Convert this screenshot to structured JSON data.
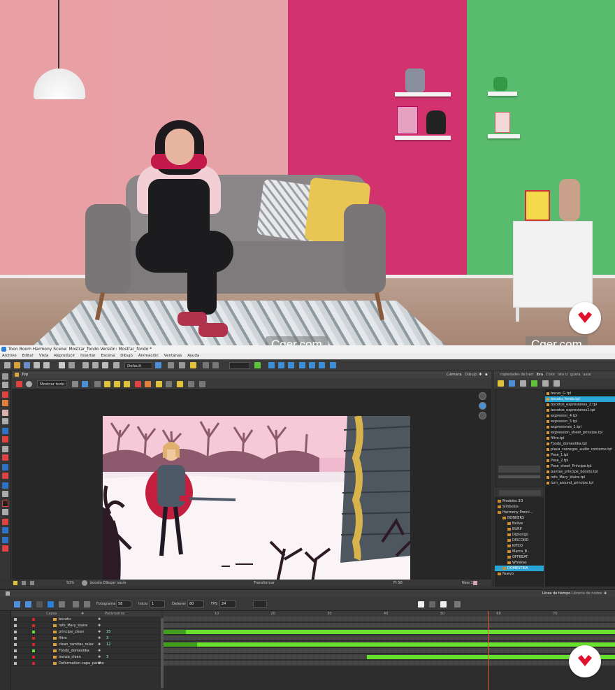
{
  "watermarks": [
    "Cger.com",
    "Cger.com"
  ],
  "app": {
    "title": "Toon Boom Harmony Scene: Mostrar_fondo Versión: Mostrar_fondo *",
    "menu": [
      "Archivo",
      "Editar",
      "Vista",
      "Reproducir",
      "Insertar",
      "Escena",
      "Dibujo",
      "Animación",
      "Ventanas",
      "Ayuda"
    ],
    "toolbar": {
      "workspace_select": "Default",
      "colors": {
        "accent": "#2aa6d6",
        "exposure": "#67e12d"
      }
    },
    "viewport": {
      "tab": "Top",
      "right_tabs": [
        "Cámara",
        "Dibujo"
      ],
      "show_select": "Mostrar todo",
      "status": {
        "zoom": "50%",
        "drawing": "boceto Dibujar vacío",
        "tool": "Transformar",
        "frame": "Ft 58",
        "view": "New 1"
      }
    },
    "library_panel": {
      "tabs": [
        "ropiedades de herr",
        "ibra",
        "Color",
        "ista d",
        "guera",
        "asso"
      ],
      "files": [
        "bocas_G.tpl",
        "boceto_fondo.tpl",
        "bocetos_expresiones_2.tpl",
        "bocetos_expresiones1.tpl",
        "expresion_4.tpl",
        "expresion_5.tpl",
        "expresiones_1.tpl",
        "expression_sheet_principe.tpl",
        "filtro.tpl",
        "Fondo_domestika.tpl",
        "placa_coroegos_audio_contorno.tpl",
        "Pose_1.tpl",
        "Pose_2.tpl",
        "Pose_sheet_Principe.tpl",
        "puntas_principe_boceto.tpl",
        "refe_Mary_blaire.tpl",
        "turn_around_principe.tpl"
      ],
      "selected_file": 1,
      "tree": [
        {
          "label": "Modelos 3D",
          "level": 1
        },
        {
          "label": "Símbolos",
          "level": 1
        },
        {
          "label": "Harmony Premi...",
          "level": 1
        },
        {
          "label": "BONKERS",
          "level": 2
        },
        {
          "label": "Belive",
          "level": 3
        },
        {
          "label": "BURP",
          "level": 3
        },
        {
          "label": "Diptongo",
          "level": 3
        },
        {
          "label": "DISCORD",
          "level": 3
        },
        {
          "label": "KITCO",
          "level": 3
        },
        {
          "label": "Marca_B...",
          "level": 3
        },
        {
          "label": "OFFBEAT",
          "level": 3
        },
        {
          "label": "Whiskas",
          "level": 3
        },
        {
          "label": "DOMESTIKA",
          "level": 2
        },
        {
          "label": "Nuevo",
          "level": 1
        }
      ],
      "selected_tree": 12
    },
    "timeline": {
      "tabs": [
        "Línea de tiempo",
        "Librería de nodos"
      ],
      "fields": {
        "frame_label": "Fotograma",
        "frame": "58",
        "start_label": "Inicio",
        "start": "1",
        "stop_label": "Detener",
        "stop": "80",
        "fps_label": "FPS",
        "fps": "24"
      },
      "columns": {
        "layers": "Capas",
        "params": "Parámetros"
      },
      "ruler": [
        "10",
        "20",
        "30",
        "40",
        "50",
        "60",
        "70"
      ],
      "layers": [
        {
          "name": "boceto",
          "num": ""
        },
        {
          "name": "refe_Mary_blaire",
          "num": ""
        },
        {
          "name": "principe_clean",
          "num": "15"
        },
        {
          "name": "filtro",
          "num": "3"
        },
        {
          "name": "clean_ramitas_relax",
          "num": "12"
        },
        {
          "name": "Fondo_domestika",
          "num": ""
        },
        {
          "name": "trenza_clean",
          "num": "3"
        },
        {
          "name": "Deformation-capa_parche",
          "num": ""
        }
      ],
      "exposures": [
        [],
        [],
        [
          [
            1,
            4,
            "dim"
          ],
          [
            5,
            80,
            "full"
          ]
        ],
        [],
        [
          [
            1,
            7,
            "dim"
          ],
          [
            7,
            80,
            "full"
          ]
        ],
        [],
        [
          [
            37,
            80,
            "full"
          ]
        ],
        []
      ],
      "current_frame": 58,
      "total_frames": 80
    }
  }
}
